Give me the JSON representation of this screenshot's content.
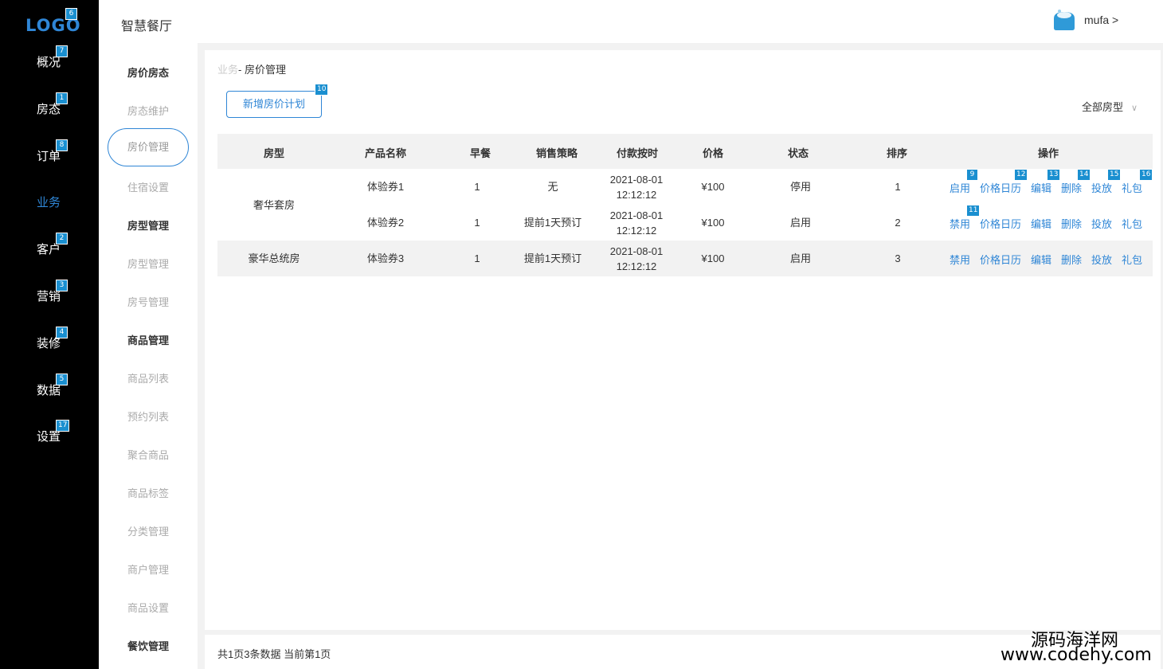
{
  "sidebar": {
    "logo": "LOGO",
    "logo_badge": "6",
    "items": [
      {
        "label": "概况",
        "badge": "7"
      },
      {
        "label": "房态",
        "badge": "1"
      },
      {
        "label": "订单",
        "badge": "8"
      },
      {
        "label": "业务",
        "badge": ""
      },
      {
        "label": "客户",
        "badge": "2"
      },
      {
        "label": "营销",
        "badge": "3"
      },
      {
        "label": "装修",
        "badge": "4"
      },
      {
        "label": "数据",
        "badge": "5"
      },
      {
        "label": "设置",
        "badge": "17"
      }
    ],
    "active": "业务"
  },
  "header": {
    "title": "智慧餐厅",
    "user": "mufa >"
  },
  "subnav": {
    "items": [
      {
        "label": "房价房态",
        "type": "head"
      },
      {
        "label": "房态维护",
        "type": "item"
      },
      {
        "label": "房价管理",
        "type": "selected"
      },
      {
        "label": "住宿设置",
        "type": "item"
      },
      {
        "label": "房型管理",
        "type": "head"
      },
      {
        "label": "房型管理",
        "type": "item"
      },
      {
        "label": "房号管理",
        "type": "item"
      },
      {
        "label": "商品管理",
        "type": "head"
      },
      {
        "label": "商品列表",
        "type": "item"
      },
      {
        "label": "预约列表",
        "type": "item"
      },
      {
        "label": "聚合商品",
        "type": "item"
      },
      {
        "label": "商品标签",
        "type": "item"
      },
      {
        "label": "分类管理",
        "type": "item"
      },
      {
        "label": "商户管理",
        "type": "item"
      },
      {
        "label": "商品设置",
        "type": "item"
      },
      {
        "label": "餐饮管理",
        "type": "head"
      }
    ]
  },
  "main": {
    "breadcrumb_parent": "业务",
    "breadcrumb_current": "- 房价管理",
    "add_button": "新增房价计划",
    "add_badge": "10",
    "room_filter": "全部房型",
    "room_filter_icon": "chevron-down-icon",
    "columns": [
      "房型",
      "产品名称",
      "早餐",
      "销售策略",
      "付款按时",
      "价格",
      "状态",
      "排序",
      "操作"
    ],
    "groups": [
      {
        "room_type": "奢华套房",
        "rows": [
          {
            "product": "体验券1",
            "breakfast": "1",
            "strategy": "无",
            "pay_date": "2021-08-01",
            "pay_time": "12:12:12",
            "price": "¥100",
            "status": "停用",
            "sort": "1",
            "actions": [
              "启用",
              "价格日历",
              "编辑",
              "删除",
              "投放",
              "礼包"
            ],
            "badges": [
              "9",
              "12",
              "13",
              "14",
              "15",
              "16"
            ]
          },
          {
            "product": "体验券2",
            "breakfast": "1",
            "strategy": "提前1天预订",
            "pay_date": "2021-08-01",
            "pay_time": "12:12:12",
            "price": "¥100",
            "status": "启用",
            "sort": "2",
            "actions": [
              "禁用",
              "价格日历",
              "编辑",
              "删除",
              "投放",
              "礼包"
            ],
            "badges": [
              "11",
              "",
              "",
              "",
              "",
              ""
            ]
          }
        ]
      },
      {
        "room_type": "豪华总统房",
        "rows": [
          {
            "product": "体验券3",
            "breakfast": "1",
            "strategy": "提前1天预订",
            "pay_date": "2021-08-01",
            "pay_time": "12:12:12",
            "price": "¥100",
            "status": "启用",
            "sort": "3",
            "actions": [
              "禁用",
              "价格日历",
              "编辑",
              "删除",
              "投放",
              "礼包"
            ],
            "badges": [
              "",
              "",
              "",
              "",
              "",
              ""
            ]
          }
        ]
      }
    ]
  },
  "footer": {
    "summary": "共1页3条数据 当前第1页"
  },
  "watermark": {
    "line1": "源码海洋网",
    "line2": "www.codehy.com"
  },
  "colors": {
    "accent": "#2f86d6",
    "sidebar_bg": "#000000",
    "badge": "#1a8fd0"
  }
}
